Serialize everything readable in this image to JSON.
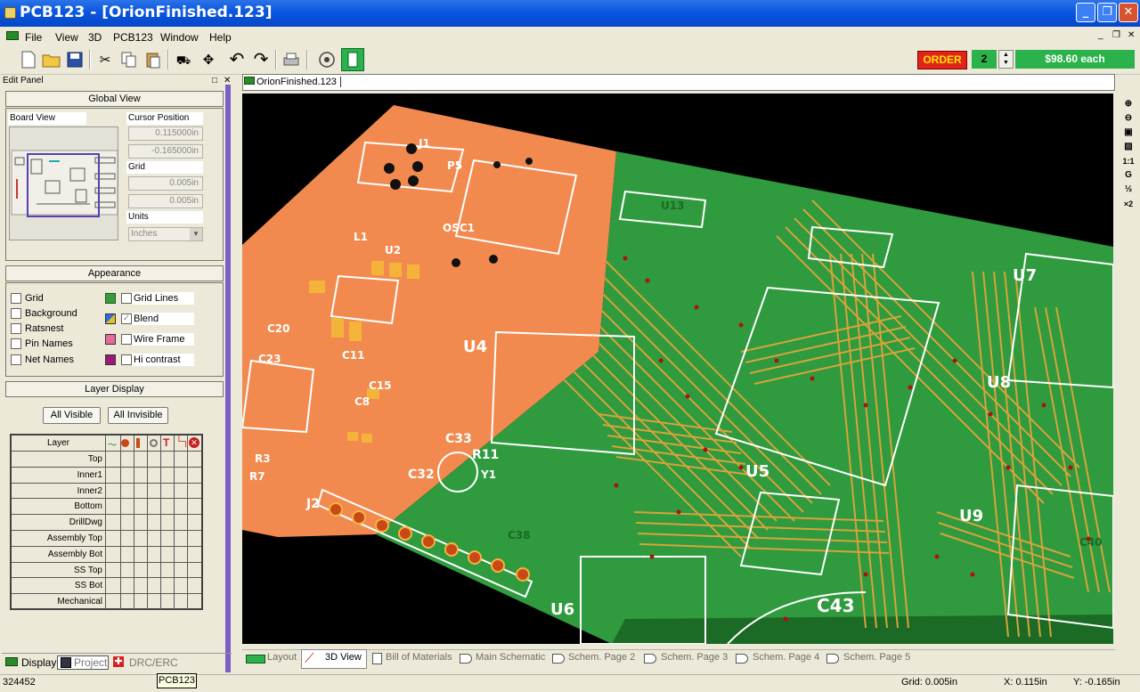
{
  "window": {
    "title": "PCB123 - [OrionFinished.123]",
    "min": "_",
    "max": "❐",
    "close": "✕"
  },
  "menu": [
    "File",
    "View",
    "3D",
    "PCB123",
    "Window",
    "Help"
  ],
  "mdi_controls": [
    "_",
    "❐",
    "✕"
  ],
  "order": {
    "label": "ORDER",
    "quantity": "2",
    "price": "$98.60 each"
  },
  "edit_panel": {
    "title": "Edit Panel",
    "global_view": "Global View",
    "board_view": "Board View",
    "cursor_position": "Cursor Position",
    "cursor_x": "0.115000in",
    "cursor_y": "-0.165000in",
    "grid": "Grid",
    "grid_x": "0.005in",
    "grid_y": "0.005in",
    "units": "Units",
    "units_value": "Inches",
    "appearance": "Appearance",
    "appearance_left": [
      "Grid",
      "Background",
      "Ratsnest",
      "Pin Names",
      "Net Names"
    ],
    "appearance_right": [
      "Grid Lines",
      "Blend",
      "Wire Frame",
      "Hi contrast"
    ],
    "layer_display": "Layer Display",
    "all_visible": "All Visible",
    "all_invisible": "All Invisible",
    "layer_header": "Layer",
    "layers": [
      "Top",
      "Inner1",
      "Inner2",
      "Bottom",
      "DrillDwg",
      "Assembly Top",
      "Assembly Bot",
      "SS Top",
      "SS Bot",
      "Mechanical"
    ]
  },
  "panel_tabs": [
    "Display",
    "Project",
    "DRC/ERC"
  ],
  "document_tab": "OrionFinished.123",
  "view_tabs": [
    "Layout",
    "3D View",
    "Bill of Materials",
    "Main Schematic",
    "Schem. Page 2",
    "Schem. Page 3",
    "Schem. Page 4",
    "Schem. Page 5"
  ],
  "vtools": [
    "⊕",
    "⊖",
    "▣",
    "▨",
    "1:1",
    "G",
    "½",
    "×2"
  ],
  "pcb_labels": [
    "J1",
    "P5",
    "OSC1",
    "U13",
    "U2",
    "L1",
    "U4",
    "U5",
    "U7",
    "U8",
    "U9",
    "U6",
    "C43",
    "C33",
    "C32",
    "R11",
    "J2",
    "C15",
    "C8",
    "C11",
    "C23",
    "C20",
    "R3",
    "R7",
    "Y1",
    "C38",
    "C40"
  ],
  "status": {
    "left": "324452",
    "tooltip": "PCB123",
    "grid": "Grid: 0.005in",
    "x": "X: 0.115in",
    "y": "Y: -0.165in"
  },
  "colors": {
    "board_orange": "#f28a4f",
    "board_green": "#2f9a3e",
    "copper": "#d6a43a",
    "silk": "#ffffff",
    "order_red": "#e2231a",
    "order_yellow": "#ffe600",
    "price_green": "#2bb24a"
  }
}
